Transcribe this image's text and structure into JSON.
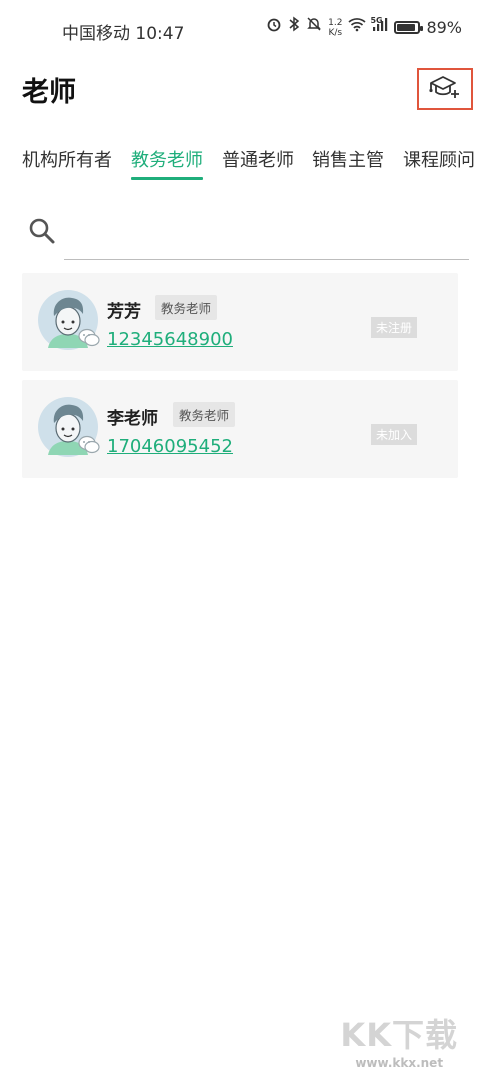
{
  "status_bar": {
    "carrier_time": "中国移动 10:47",
    "net_speed_value": "1.2",
    "net_speed_unit": "K/s",
    "network_type": "5G",
    "battery_percent": "89%",
    "battery_level": 0.89,
    "icons": [
      "alarm-icon",
      "bluetooth-icon",
      "mute-icon",
      "wifi-icon",
      "signal-icon",
      "battery-icon"
    ]
  },
  "header": {
    "title": "老师",
    "add_icon": "graduation-cap-plus-icon"
  },
  "tabs": [
    {
      "label": "机构所有者",
      "active": false
    },
    {
      "label": "教务老师",
      "active": true
    },
    {
      "label": "普通老师",
      "active": false
    },
    {
      "label": "销售主管",
      "active": false
    },
    {
      "label": "课程顾问",
      "active": false
    }
  ],
  "search": {
    "placeholder": "",
    "value": ""
  },
  "teachers": [
    {
      "name": "芳芳",
      "role": "教务老师",
      "phone": "12345648900",
      "status": "未注册"
    },
    {
      "name": "李老师",
      "role": "教务老师",
      "phone": "17046095452",
      "status": "未加入"
    }
  ],
  "watermark": {
    "text": "KK下载",
    "url": "www.kkx.net"
  },
  "colors": {
    "accent": "#1fae7b",
    "highlight_border": "#e0553c",
    "card_bg": "#f6f6f6"
  }
}
